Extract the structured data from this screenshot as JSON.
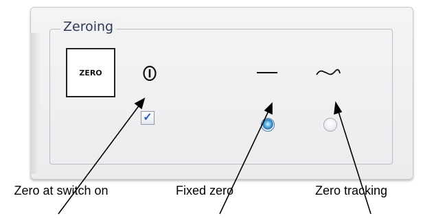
{
  "group": {
    "title": "Zeroing"
  },
  "zero_button": {
    "label": "ZERO"
  },
  "zero_at_switch_on": {
    "checked": true,
    "check_glyph": "✓"
  },
  "mode": {
    "selected": "fixed_zero"
  },
  "icons": {
    "power": "power-icon",
    "fixed": "flat-line-icon",
    "tracking": "wave-icon"
  },
  "captions": {
    "zero_at_switch_on": "Zero at switch on",
    "fixed_zero": "Fixed zero",
    "zero_tracking": "Zero tracking"
  },
  "colors": {
    "title_text": "#2b3a57",
    "checkmark": "#2f59c9",
    "radio_selected": "#2a6fa8"
  }
}
